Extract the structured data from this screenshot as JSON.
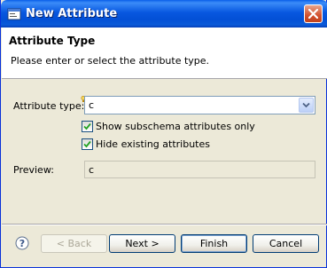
{
  "window": {
    "title": "New Attribute"
  },
  "header": {
    "title": "Attribute Type",
    "description": "Please enter or select the attribute type."
  },
  "form": {
    "attribute_type_label": "Attribute type:",
    "attribute_type_value": "c",
    "show_subschema_label": "Show subschema attributes only",
    "show_subschema_checked": true,
    "hide_existing_label": "Hide existing attributes",
    "hide_existing_checked": true,
    "preview_label": "Preview:",
    "preview_value": "c"
  },
  "buttons": {
    "back": "< Back",
    "next": "Next >",
    "finish": "Finish",
    "cancel": "Cancel"
  },
  "icons": {
    "title": "app-window-icon",
    "close": "close-icon",
    "help": "help-icon",
    "dropdown": "chevron-down-icon",
    "content_assist": "lightbulb-icon"
  },
  "colors": {
    "titlebar": "#0A5FE8",
    "dialog_background": "#ECE9D8",
    "header_background": "#FFFFFF",
    "close_button": "#D2502E"
  }
}
